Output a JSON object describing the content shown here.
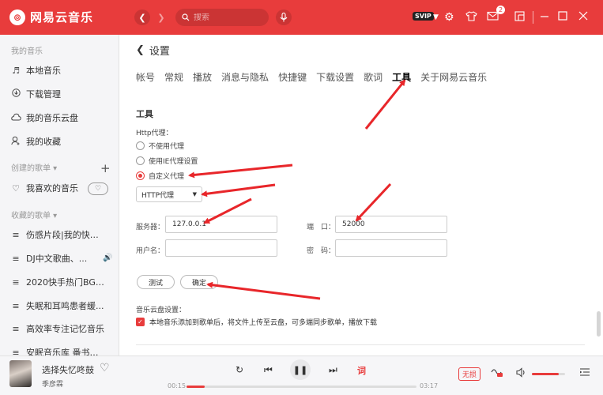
{
  "app": {
    "logo_glyph": "⊚",
    "name": "网易云音乐"
  },
  "titlebar": {
    "search_placeholder": "搜索",
    "vip_label": "SVIP",
    "message_count": "2"
  },
  "sidebar": {
    "my_music_title": "我的音乐",
    "my_music_items": [
      {
        "icon": "music-note-icon",
        "label": "本地音乐"
      },
      {
        "icon": "download-icon",
        "label": "下载管理"
      },
      {
        "icon": "cloud-icon",
        "label": "我的音乐云盘"
      },
      {
        "icon": "collection-icon",
        "label": "我的收藏"
      }
    ],
    "created_title": "创建的歌单 ▾",
    "liked_label": "我喜欢的音乐",
    "collected_title": "收藏的歌单 ▾",
    "collected_items": [
      "伤感片段|我的快乐...",
      "DJ中文歌曲、...",
      "2020快手热门BGM...",
      "失眠和耳鸣患者缓...",
      "高效率专注记忆音乐",
      "安眠音乐库 番书籍..."
    ]
  },
  "settings": {
    "back_label": "设置",
    "tabs": [
      "帐号",
      "常规",
      "播放",
      "消息与隐私",
      "快捷键",
      "下载设置",
      "歌词",
      "工具",
      "关于网易云音乐"
    ],
    "active_tab": "工具",
    "section_title": "工具",
    "proxy_label": "Http代理：",
    "proxy_options": [
      "不使用代理",
      "使用IE代理设置",
      "自定义代理"
    ],
    "selected_proxy_index": 2,
    "proxy_type_value": "HTTP代理",
    "server_label": "服务器：",
    "server_value": "127.0.0.1",
    "port_label": "端　口：",
    "port_value": "52000",
    "username_label": "用户名：",
    "username_value": "",
    "password_label": "密　码：",
    "password_value": "",
    "test_button": "测试",
    "confirm_button": "确定",
    "cloud_settings_label": "音乐云盘设置：",
    "cloud_checkbox_text": "本地音乐添加到歌单后，将文件上传至云盘，可多端同步歌单，播放下载",
    "cloud_checkbox_checked": true
  },
  "player": {
    "song_title": "选择失忆咚鼓",
    "artist": "季彦霖",
    "current_time": "00:15",
    "total_time": "03:17",
    "progress": 0.08,
    "quality_label": "无损",
    "volume": 0.8
  },
  "colors": {
    "brand": "#e83c3c",
    "sidebar_bg": "#f5f5f7"
  }
}
